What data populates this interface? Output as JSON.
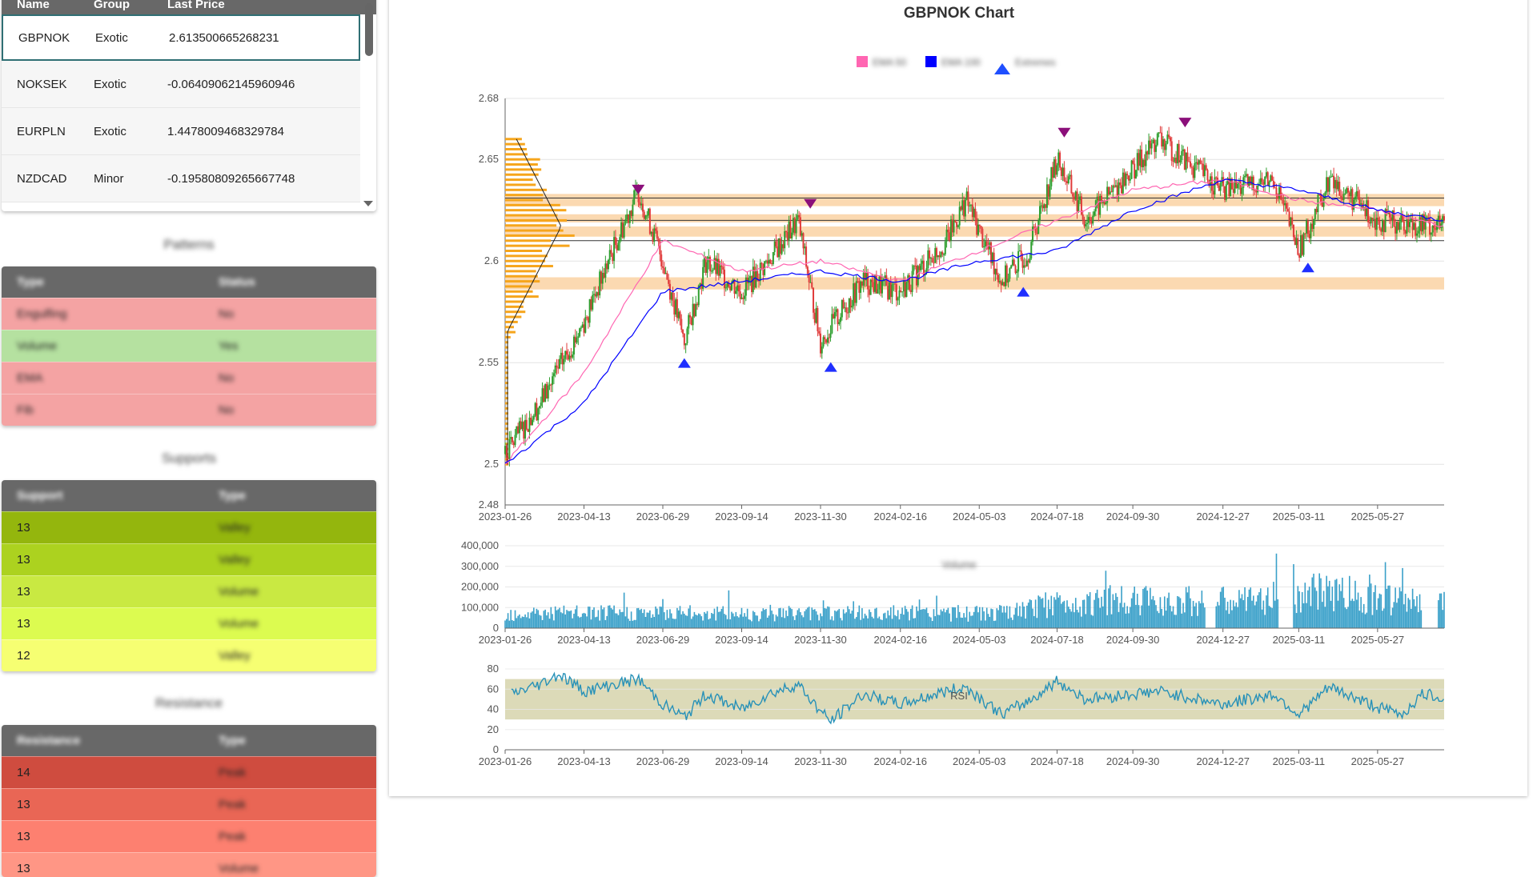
{
  "watchlist": {
    "columns": [
      "Name",
      "Group",
      "Last Price"
    ],
    "rows": [
      {
        "name": "GBPNOK",
        "group": "Exotic",
        "price": "2.613500665268231"
      },
      {
        "name": "NOKSEK",
        "group": "Exotic",
        "price": "-0.06409062145960946"
      },
      {
        "name": "EURPLN",
        "group": "Exotic",
        "price": "1.4478009468329784"
      },
      {
        "name": "NZDCAD",
        "group": "Minor",
        "price": "-0.19580809265667748"
      }
    ]
  },
  "sidebar_tables": [
    {
      "title": "Patterns",
      "columns": [
        "Type",
        "Status"
      ],
      "rows": [
        {
          "c1": "Engulfing",
          "c2": "No",
          "color": "#f4a3a3"
        },
        {
          "c1": "Volume",
          "c2": "Yes",
          "color": "#b5e1a0"
        },
        {
          "c1": "EMA",
          "c2": "No",
          "color": "#f4a3a3"
        },
        {
          "c1": "Fib",
          "c2": "No",
          "color": "#f4a3a3"
        }
      ]
    },
    {
      "title": "Supports",
      "columns": [
        "Support",
        "Type"
      ],
      "rows": [
        {
          "c1": "13",
          "c2": "Valley",
          "color": "#94b60d"
        },
        {
          "c1": "13",
          "c2": "Valley",
          "color": "#acd21f"
        },
        {
          "c1": "13",
          "c2": "Volume",
          "color": "#c9e942"
        },
        {
          "c1": "13",
          "c2": "Volume",
          "color": "#dcfb50"
        },
        {
          "c1": "12",
          "c2": "Valley",
          "color": "#f6ff72"
        }
      ]
    },
    {
      "title": "Resistance",
      "columns": [
        "Resistance",
        "Type"
      ],
      "rows": [
        {
          "c1": "14",
          "c2": "Peak",
          "color": "#cf4c3f"
        },
        {
          "c1": "13",
          "c2": "Peak",
          "color": "#e96655"
        },
        {
          "c1": "13",
          "c2": "Peak",
          "color": "#fd8070"
        },
        {
          "c1": "13",
          "c2": "Volume",
          "color": "#ff9685"
        }
      ]
    }
  ],
  "chart": {
    "title": "GBPNOK Chart",
    "legend": [
      {
        "label": "EMA 50",
        "color": "#ff66b2",
        "shape": "square"
      },
      {
        "label": "EMA 100",
        "color": "#0000ff",
        "shape": "square"
      },
      {
        "label": "Extremes",
        "color": "#1f4fff",
        "shape": "triangle-up"
      }
    ],
    "volume_label": "Volume",
    "rsi_label": "RSI",
    "x_ticks": [
      "2023-01-26",
      "2023-04-13",
      "2023-06-29",
      "2023-09-14",
      "2023-11-30",
      "2024-02-16",
      "2024-05-03",
      "2024-07-18",
      "2024-09-30",
      "2024-12-27",
      "2025-03-11",
      "2025-05-27"
    ]
  },
  "chart_data": [
    {
      "type": "candlestick",
      "title": "GBPNOK Chart",
      "x_range": [
        "2023-01-26",
        "2025-07-31"
      ],
      "ylim": [
        2.48,
        2.68
      ],
      "y_ticks": [
        "2.48",
        "2.5",
        "2.55",
        "2.6",
        "2.65",
        "2.68"
      ],
      "close_path": [
        [
          "2023-01-26",
          2.505
        ],
        [
          "2023-03-01",
          2.53
        ],
        [
          "2023-04-13",
          2.57
        ],
        [
          "2023-05-15",
          2.61
        ],
        [
          "2023-06-05",
          2.635
        ],
        [
          "2023-06-29",
          2.6
        ],
        [
          "2023-07-20",
          2.56
        ],
        [
          "2023-08-10",
          2.6
        ],
        [
          "2023-09-14",
          2.585
        ],
        [
          "2023-10-10",
          2.6
        ],
        [
          "2023-11-08",
          2.62
        ],
        [
          "2023-11-30",
          2.56
        ],
        [
          "2024-01-10",
          2.59
        ],
        [
          "2024-02-16",
          2.585
        ],
        [
          "2024-04-01",
          2.61
        ],
        [
          "2024-04-20",
          2.63
        ],
        [
          "2024-05-25",
          2.59
        ],
        [
          "2024-06-20",
          2.605
        ],
        [
          "2024-07-18",
          2.65
        ],
        [
          "2024-08-15",
          2.62
        ],
        [
          "2024-09-30",
          2.645
        ],
        [
          "2024-10-25",
          2.66
        ],
        [
          "2024-12-27",
          2.635
        ],
        [
          "2025-02-15",
          2.64
        ],
        [
          "2025-03-11",
          2.605
        ],
        [
          "2025-04-10",
          2.64
        ],
        [
          "2025-05-27",
          2.62
        ],
        [
          "2025-07-31",
          2.617
        ]
      ],
      "series": [
        {
          "name": "EMA 50",
          "values": [
            [
              "2023-01-26",
              2.5
            ],
            [
              "2023-04-13",
              2.545
            ],
            [
              "2023-06-29",
              2.61
            ],
            [
              "2023-09-14",
              2.595
            ],
            [
              "2023-11-30",
              2.6
            ],
            [
              "2024-02-16",
              2.59
            ],
            [
              "2024-05-03",
              2.605
            ],
            [
              "2024-07-18",
              2.62
            ],
            [
              "2024-09-30",
              2.635
            ],
            [
              "2024-12-27",
              2.64
            ],
            [
              "2025-03-11",
              2.63
            ],
            [
              "2025-05-27",
              2.625
            ],
            [
              "2025-07-31",
              2.617
            ]
          ]
        },
        {
          "name": "EMA 100",
          "values": [
            [
              "2023-01-26",
              2.5
            ],
            [
              "2023-04-13",
              2.53
            ],
            [
              "2023-06-29",
              2.585
            ],
            [
              "2023-09-14",
              2.59
            ],
            [
              "2023-11-30",
              2.595
            ],
            [
              "2024-02-16",
              2.59
            ],
            [
              "2024-05-03",
              2.6
            ],
            [
              "2024-07-18",
              2.605
            ],
            [
              "2024-09-30",
              2.625
            ],
            [
              "2024-12-27",
              2.64
            ],
            [
              "2025-03-11",
              2.635
            ],
            [
              "2025-05-27",
              2.625
            ],
            [
              "2025-07-31",
              2.62
            ]
          ]
        }
      ],
      "extremes": [
        {
          "date": "2023-06-05",
          "value": 2.632,
          "kind": "peak"
        },
        {
          "date": "2023-07-20",
          "value": 2.553,
          "kind": "valley"
        },
        {
          "date": "2023-11-20",
          "value": 2.625,
          "kind": "peak"
        },
        {
          "date": "2023-12-10",
          "value": 2.551,
          "kind": "valley"
        },
        {
          "date": "2024-06-15",
          "value": 2.588,
          "kind": "valley"
        },
        {
          "date": "2024-07-25",
          "value": 2.66,
          "kind": "peak"
        },
        {
          "date": "2024-11-20",
          "value": 2.665,
          "kind": "peak"
        },
        {
          "date": "2025-03-20",
          "value": 2.6,
          "kind": "valley"
        }
      ],
      "levels": [
        {
          "from": 2.627,
          "to": 2.633
        },
        {
          "from": 2.619,
          "to": 2.623
        },
        {
          "from": 2.612,
          "to": 2.617
        },
        {
          "from": 2.586,
          "to": 2.592
        }
      ],
      "level_lines": [
        2.631,
        2.62,
        2.61
      ],
      "volume_profile": {
        "from": 2.5,
        "to": 2.66,
        "peak_price": 2.617
      }
    },
    {
      "type": "bar",
      "title": "Volume",
      "ylim": [
        0,
        400000
      ],
      "y_ticks": [
        "400,000",
        "300,000",
        "200,000",
        "100,000",
        "0"
      ],
      "profile": [
        [
          "2023-01-26",
          90000
        ],
        [
          "2024-06-01",
          90000
        ],
        [
          "2024-07-18",
          150000
        ],
        [
          "2024-09-30",
          170000
        ],
        [
          "2025-01-15",
          160000
        ],
        [
          "2025-03-11",
          200000
        ],
        [
          "2025-04-15",
          230000
        ],
        [
          "2025-05-27",
          170000
        ],
        [
          "2025-07-31",
          150000
        ]
      ],
      "gaps": [
        [
          "2024-12-10",
          "2024-12-20"
        ],
        [
          "2025-02-20",
          "2025-03-05"
        ],
        [
          "2025-07-10",
          "2025-07-25"
        ]
      ]
    },
    {
      "type": "line",
      "title": "RSI",
      "ylim": [
        0,
        80
      ],
      "y_ticks": [
        "80",
        "60",
        "40",
        "20",
        "0"
      ],
      "band": [
        30,
        70
      ],
      "values": [
        [
          "2023-02-01",
          55
        ],
        [
          "2023-03-01",
          65
        ],
        [
          "2023-03-20",
          75
        ],
        [
          "2023-04-13",
          58
        ],
        [
          "2023-05-15",
          65
        ],
        [
          "2023-06-05",
          70
        ],
        [
          "2023-06-29",
          45
        ],
        [
          "2023-07-20",
          32
        ],
        [
          "2023-08-10",
          55
        ],
        [
          "2023-09-14",
          40
        ],
        [
          "2023-10-10",
          55
        ],
        [
          "2023-11-08",
          65
        ],
        [
          "2023-11-30",
          38
        ],
        [
          "2023-12-10",
          28
        ],
        [
          "2024-01-10",
          55
        ],
        [
          "2024-02-16",
          45
        ],
        [
          "2024-04-01",
          58
        ],
        [
          "2024-04-20",
          62
        ],
        [
          "2024-05-25",
          35
        ],
        [
          "2024-06-20",
          48
        ],
        [
          "2024-07-18",
          68
        ],
        [
          "2024-08-15",
          50
        ],
        [
          "2024-09-30",
          55
        ],
        [
          "2024-10-25",
          58
        ],
        [
          "2024-12-27",
          45
        ],
        [
          "2025-02-15",
          55
        ],
        [
          "2025-03-11",
          35
        ],
        [
          "2025-04-10",
          62
        ],
        [
          "2025-05-27",
          42
        ],
        [
          "2025-06-20",
          35
        ],
        [
          "2025-07-10",
          55
        ],
        [
          "2025-07-31",
          52
        ]
      ]
    }
  ]
}
